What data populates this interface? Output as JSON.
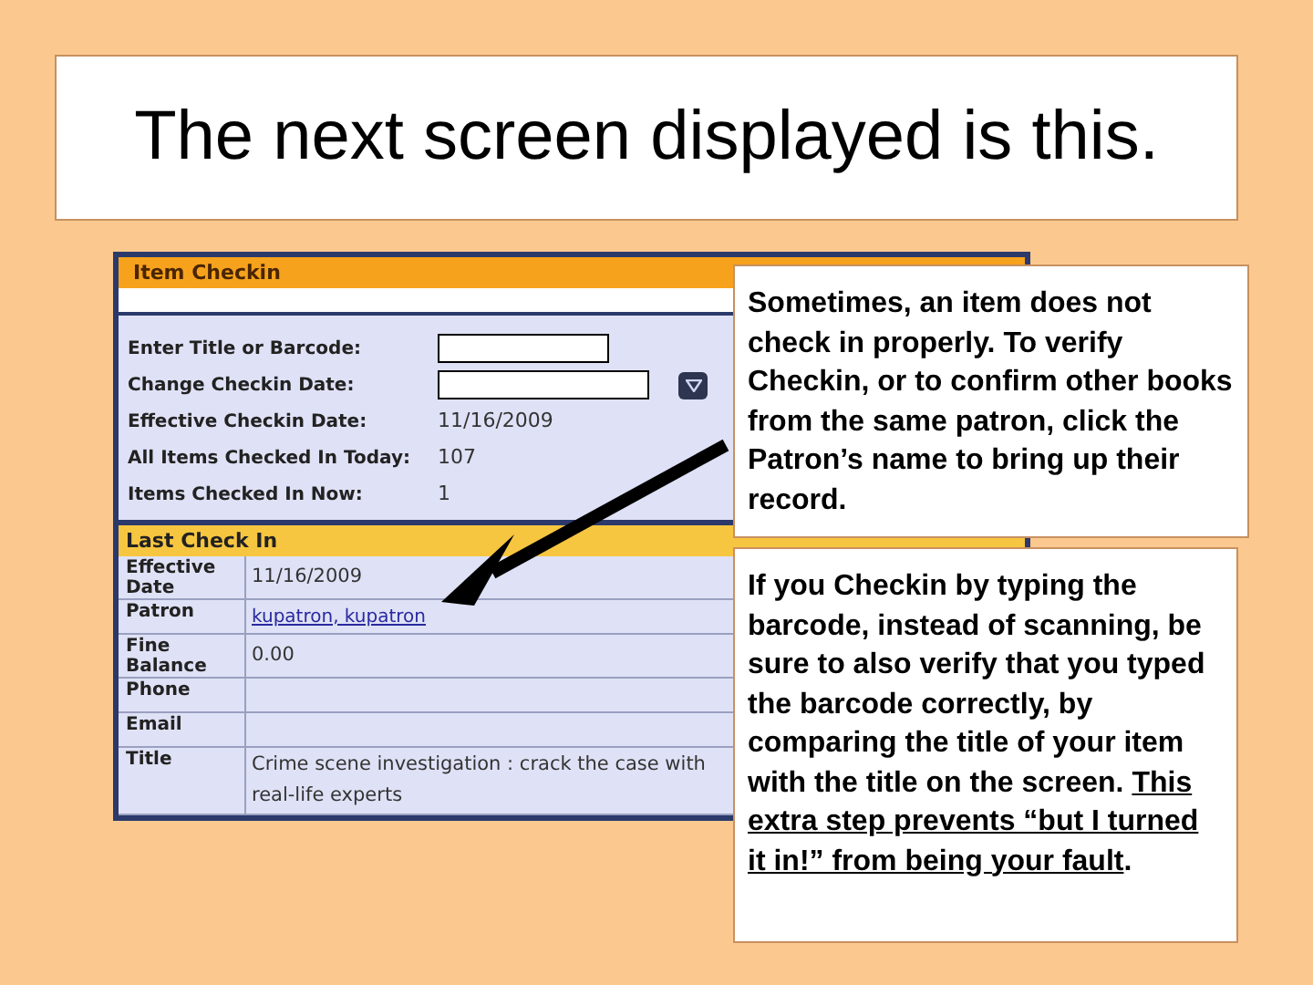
{
  "slide_title": "The next screen displayed is this.",
  "screenshot": {
    "header": "Item Checkin",
    "form": [
      {
        "kind": "input",
        "label": "Enter Title or Barcode:"
      },
      {
        "kind": "date_input",
        "label": "Change Checkin Date:"
      },
      {
        "kind": "text",
        "label": "Effective Checkin Date:",
        "value": "11/16/2009"
      },
      {
        "kind": "text",
        "label": "All Items Checked In Today:",
        "value": "107"
      },
      {
        "kind": "text",
        "label": "Items Checked In Now:",
        "value": "1"
      }
    ],
    "last_check_in": {
      "header": "Last Check In",
      "rows": [
        {
          "kind": "text",
          "label": "Effective Date",
          "value": "11/16/2009"
        },
        {
          "kind": "link",
          "label": "Patron",
          "value": "kupatron, kupatron"
        },
        {
          "kind": "text",
          "label": "Fine Balance",
          "value": "0.00"
        },
        {
          "kind": "empty",
          "label": "Phone"
        },
        {
          "kind": "empty",
          "label": "Email"
        },
        {
          "kind": "text",
          "label": "Title",
          "value": "Crime scene investigation : crack the case with real-life experts"
        }
      ]
    }
  },
  "callouts": [
    {
      "text": "Sometimes, an item does not check in properly. To verify Checkin, or to confirm other books from the same patron, click the Patron’s name to bring up their record."
    },
    {
      "text": "If you Checkin by typing the barcode, instead of scanning, be sure to also verify that you typed the barcode correctly, by comparing the title of your item with the title on the screen. ",
      "underlined": "This extra step prevents “but I turned it in!” from being your fault",
      "after": "."
    }
  ]
}
